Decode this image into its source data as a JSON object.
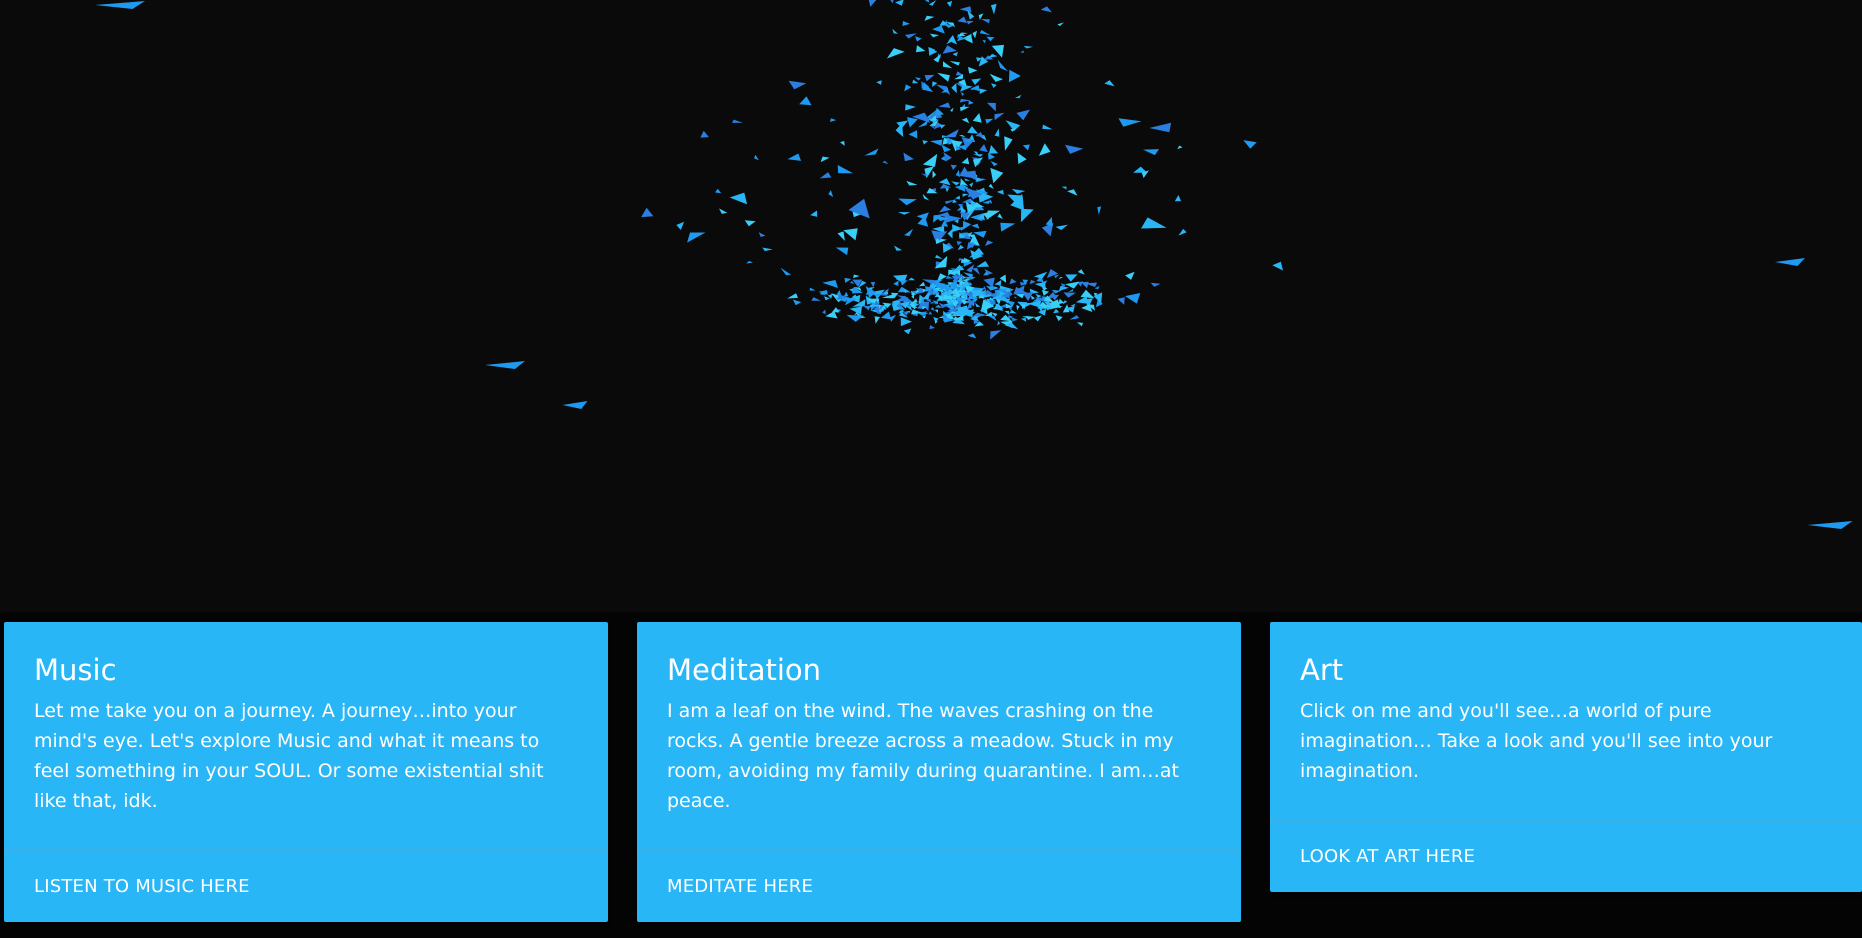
{
  "hero": {
    "particle_colors": [
      "#1e9bf0",
      "#29b6f6",
      "#39d0f7",
      "#2a7fe0"
    ],
    "background": "#0a0a0b"
  },
  "cards": [
    {
      "title": "Music",
      "text": "Let me take you on a journey. A journey…into your mind's eye. Let's explore Music and what it means to feel something in your SOUL. Or some existential shit like that, idk.",
      "action": "LISTEN TO MUSIC HERE"
    },
    {
      "title": "Meditation",
      "text": "I am a leaf on the wind. The waves crashing on the rocks. A gentle breeze across a meadow. Stuck in my room, avoiding my family during quarantine. I am…at peace.",
      "action": "MEDITATE HERE"
    },
    {
      "title": "Art",
      "text": "Click on me and you'll see…a world of pure imagination… Take a look and you'll see into your imagination.",
      "action": "LOOK AT ART HERE"
    }
  ],
  "accent_color": "#29b6f6"
}
